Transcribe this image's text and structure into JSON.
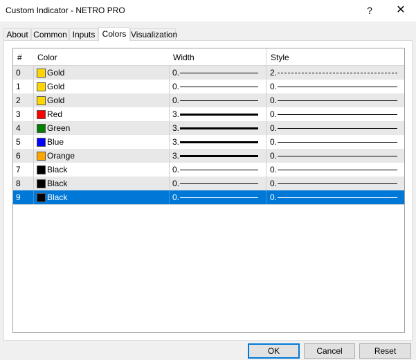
{
  "window": {
    "title": "Custom Indicator - NETRO PRO",
    "help": "?",
    "close": "✕"
  },
  "tabs": [
    "About",
    "Common",
    "Inputs",
    "Colors",
    "Visualization"
  ],
  "active_tab": "Colors",
  "grid": {
    "headers": {
      "num": "#",
      "color": "Color",
      "width": "Width",
      "style": "Style"
    },
    "rows": [
      {
        "num": "0",
        "color": "Gold",
        "swatch": "#ffd700",
        "width": "0.",
        "style": "2."
      },
      {
        "num": "1",
        "color": "Gold",
        "swatch": "#ffd700",
        "width": "0.",
        "style": "0."
      },
      {
        "num": "2",
        "color": "Gold",
        "swatch": "#ffd700",
        "width": "0.",
        "style": "0."
      },
      {
        "num": "3",
        "color": "Red",
        "swatch": "#ff0000",
        "width": "3.",
        "style": "0."
      },
      {
        "num": "4",
        "color": "Green",
        "swatch": "#008000",
        "width": "3.",
        "style": "0."
      },
      {
        "num": "5",
        "color": "Blue",
        "swatch": "#0000ff",
        "width": "3.",
        "style": "0."
      },
      {
        "num": "6",
        "color": "Orange",
        "swatch": "#ffa500",
        "width": "3.",
        "style": "0."
      },
      {
        "num": "7",
        "color": "Black",
        "swatch": "#000000",
        "width": "0.",
        "style": "0."
      },
      {
        "num": "8",
        "color": "Black",
        "swatch": "#000000",
        "width": "0.",
        "style": "0."
      },
      {
        "num": "9",
        "color": "Black",
        "swatch": "#000000",
        "width": "0.",
        "style": "0."
      }
    ],
    "selected_row": "9"
  },
  "buttons": {
    "ok": "OK",
    "cancel": "Cancel",
    "reset": "Reset"
  }
}
